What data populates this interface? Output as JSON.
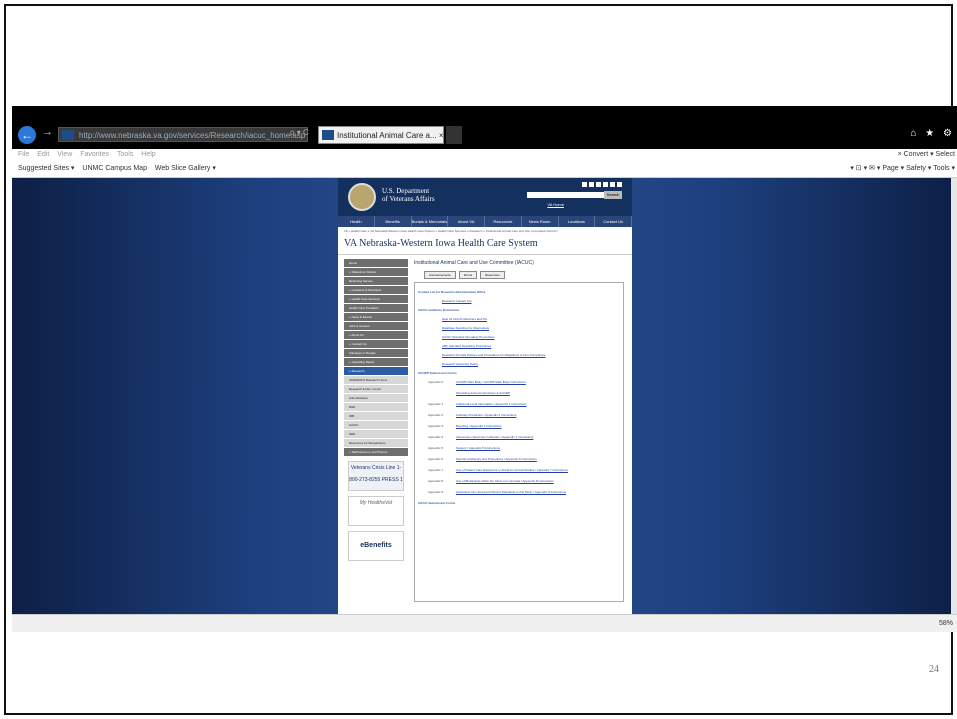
{
  "slide": {
    "number": "24"
  },
  "browser": {
    "address": "http://www.nebraska.va.gov/services/Research/iacuc_home.asp",
    "address_controls": "ρ ▾ C",
    "tab_title": "Institutional Animal Care a...  ×",
    "window_controls": "⌂ ★ ⚙",
    "menu": [
      "File",
      "Edit",
      "View",
      "Favorites",
      "Tools",
      "Help"
    ],
    "menu_right": "×  Convert ▾  Select",
    "favorites": [
      "Suggested Sites ▾",
      "UNMC Campus Map",
      "Web Slice Gallery ▾"
    ],
    "toolbar_right": "▾ ⊡ ▾ ✉ ▾ Page ▾  Safety ▾  Tools ▾",
    "zoom": "58%"
  },
  "va": {
    "dept_line1": "U.S. Department",
    "dept_line2": "of Veterans Affairs",
    "search_button": "Search",
    "search_link": "VA Home",
    "nav": [
      "Health",
      "Benefits",
      "Burials & Memorials",
      "About VA",
      "Resources",
      "News Room",
      "Locations",
      "Contact Us"
    ],
    "breadcrumb": "VA » Health Care » VA Nebraska-Western Iowa Health Care System » Health Care Services » Research » Institutional Animal Care and Use Committee (IACUC)",
    "site_title": "VA Nebraska-Western Iowa Health Care System",
    "page_title": "Institutional Animal Care and Use Committee (IACUC)",
    "tabs": [
      "Announcements",
      "Forms",
      "Resources"
    ],
    "sidebar": [
      {
        "label": "Home",
        "type": "main"
      },
      {
        "label": "+ Patients & Visitors",
        "type": "main"
      },
      {
        "label": "Returning Service",
        "type": "main"
      },
      {
        "label": "+ Locations & Directions",
        "type": "main"
      },
      {
        "label": "+ Health Care Services",
        "type": "main"
      },
      {
        "label": "Health Care Providers",
        "type": "main"
      },
      {
        "label": "+ News & Events",
        "type": "main"
      },
      {
        "label": "Jobs & Careers",
        "type": "main"
      },
      {
        "label": "+ About Us",
        "type": "main"
      },
      {
        "label": "+ Contact Us",
        "type": "main"
      },
      {
        "label": "Volunteer or Donate",
        "type": "main"
      },
      {
        "label": "+ Operating Status",
        "type": "main"
      },
      {
        "label": "+ Research",
        "type": "active"
      },
      {
        "label": "VANWIHCS Research Home",
        "type": "sub"
      },
      {
        "label": "Research & Dev. Comm.",
        "type": "sub"
      },
      {
        "label": "Administration",
        "type": "sub"
      },
      {
        "label": "R&D",
        "type": "sub"
      },
      {
        "label": "IRB",
        "type": "sub"
      },
      {
        "label": "IACUC",
        "type": "sub"
      },
      {
        "label": "SRS",
        "type": "sub"
      },
      {
        "label": "Resources for Researchers",
        "type": "sub"
      },
      {
        "label": "+ Staff Directory and Phones",
        "type": "main"
      }
    ],
    "promos": {
      "crisis_line": "Veterans Crisis Line 1-800-273-8255 PRESS 1",
      "mhv": "My HealtheVet",
      "benefits": "eBenefits"
    },
    "sections": {
      "contact": {
        "heading": "Contact List for Research Administrative Office",
        "links": [
          "Research Contact List"
        ]
      },
      "guidance": {
        "heading": "IACUC Guidance Documents",
        "links": [
          "Help for IACUC Members and PIs",
          "Database Searches for Alternatives",
          "IACUC Standard Operating Procedures",
          "ARF Standard Operating Procedures",
          "Research Animals Policies and Procedures for Allegations of Non-Compliance",
          "Research Veterinary Policy"
        ]
      },
      "acorp": {
        "heading": "ACORP Submission Forms",
        "items": [
          {
            "label": "Appendix A",
            "link": "ACORP Main Body / ACORP Main Body Instructions"
          },
          {
            "label": "",
            "link": "Shredding Animal Instructions & ACORP"
          },
          {
            "label": "Appendix 1",
            "link": "Additional Local Information / Appendix 1 Instructions"
          },
          {
            "label": "Appendix 2",
            "link": "Antibody Production / Appendix 2 Instructions"
          },
          {
            "label": "Appendix 3",
            "link": "Breeding / Appendix 3 Instructions"
          },
          {
            "label": "Appendix 4",
            "link": "Intervention Specimen Collection / Appendix 4 Instructions"
          },
          {
            "label": "Appendix 5",
            "link": "Surgery / Appendix 5 Instructions"
          },
          {
            "label": "Appendix 6",
            "link": "Special Husbandry and Procedures / Appendix 6 Instructions"
          },
          {
            "label": "Appendix 7",
            "link": "Use of Patient Care Equipment or Areas for Animal Studies / Appendix 7 Instructions"
          },
          {
            "label": "Appendix 8",
            "link": "Use of Biohazards within the Clinic or in Animals / Appendix 8 Instructions"
          },
          {
            "label": "Appendix 9",
            "link": "Hazardous Non-Food and Wound Standards in this Study / Appendix 9 Instructions"
          }
        ]
      },
      "submission": {
        "heading": "IACUC Submission Forms"
      }
    }
  }
}
